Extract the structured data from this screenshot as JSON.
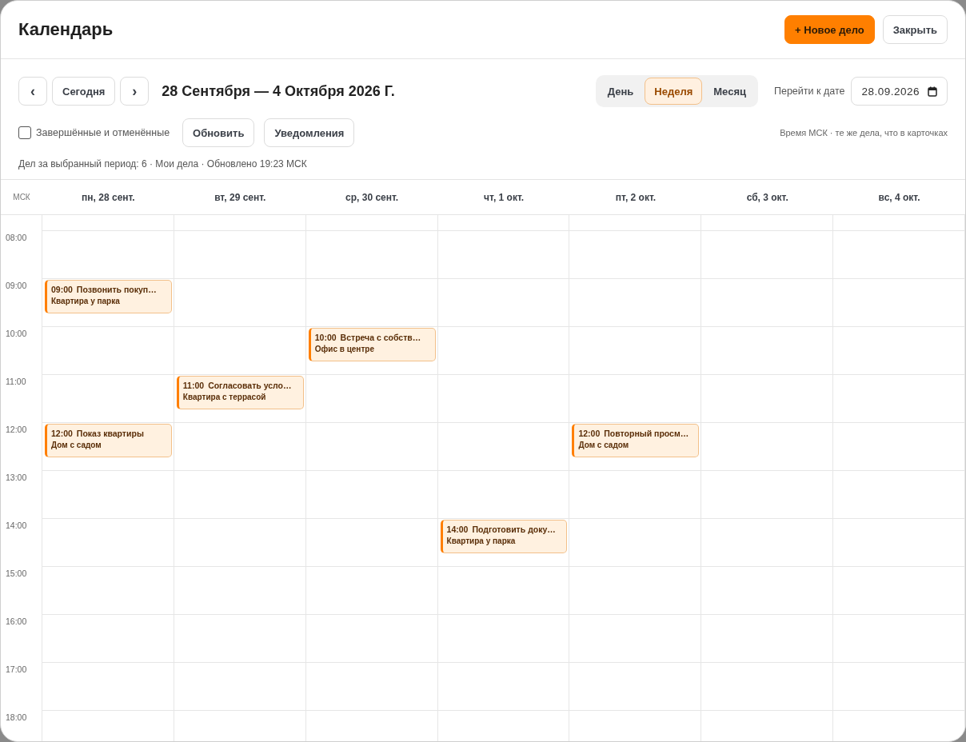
{
  "window": {
    "title": "Календарь"
  },
  "header_buttons": [
    {
      "label": "+ Новое дело",
      "kind": "primary"
    },
    {
      "label": "Закрыть",
      "kind": "secondary"
    }
  ],
  "nav": {
    "prev": "‹",
    "today": "Сегодня",
    "next": "›",
    "range": "28 Сентября — 4 Октября 2026 Г."
  },
  "views": [
    {
      "label": "День",
      "selected": false
    },
    {
      "label": "Неделя",
      "selected": true
    },
    {
      "label": "Месяц",
      "selected": false
    }
  ],
  "goto": {
    "label": "Перейти к дате",
    "value": "28.09.2026"
  },
  "filter": {
    "label": "Завершённые и отменённые",
    "checked": false
  },
  "actions": [
    "Обновить",
    "Уведомления"
  ],
  "note": "Время МСК · те же дела, что в карточках",
  "summary": "Дел за выбранный период: 6 · Мои дела · Обновлено 19:23 МСК",
  "timezone": "МСК",
  "hours": [
    "08:00",
    "09:00",
    "10:00",
    "11:00",
    "12:00",
    "13:00",
    "14:00",
    "15:00",
    "16:00",
    "17:00",
    "18:00"
  ],
  "days": [
    {
      "label": "пн, 28 сент.",
      "events": [
        {
          "time": "09:00",
          "title": "Позвонить покуп…",
          "place": "Квартира у парка"
        },
        {
          "time": "12:00",
          "title": "Показ квартиры",
          "place": "Дом с садом"
        }
      ]
    },
    {
      "label": "вт, 29 сент.",
      "events": [
        {
          "time": "11:00",
          "title": "Согласовать усло…",
          "place": "Квартира с террасой"
        }
      ]
    },
    {
      "label": "ср, 30 сент.",
      "events": [
        {
          "time": "10:00",
          "title": "Встреча с собств…",
          "place": "Офис в центре"
        }
      ]
    },
    {
      "label": "чт, 1 окт.",
      "events": [
        {
          "time": "14:00",
          "title": "Подготовить доку…",
          "place": "Квартира у парка"
        }
      ]
    },
    {
      "label": "пт, 2 окт.",
      "events": [
        {
          "time": "12:00",
          "title": "Повторный просм…",
          "place": "Дом с садом"
        }
      ]
    },
    {
      "label": "сб, 3 окт."
    },
    {
      "label": "вс, 4 окт."
    }
  ]
}
